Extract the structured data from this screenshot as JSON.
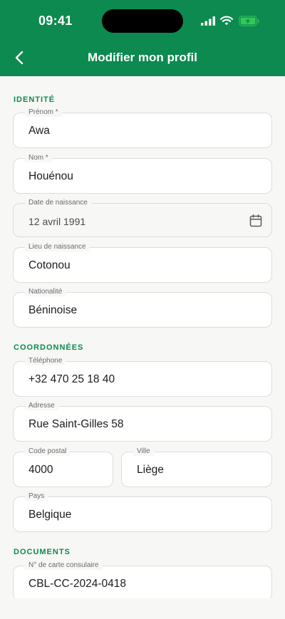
{
  "status": {
    "time": "09:41"
  },
  "nav": {
    "title": "Modifier mon profil"
  },
  "sections": {
    "identity": "IDENTITÉ",
    "contact": "COORDONNÉES",
    "documents": "DOCUMENTS"
  },
  "fields": {
    "first_name": {
      "label": "Prénom *",
      "value": "Awa"
    },
    "last_name": {
      "label": "Nom *",
      "value": "Houénou"
    },
    "birth_date": {
      "label": "Date de naissance",
      "value": "12 avril 1991"
    },
    "birth_place": {
      "label": "Lieu de naissance",
      "value": "Cotonou"
    },
    "nationality": {
      "label": "Nationalité",
      "value": "Béninoise"
    },
    "phone": {
      "label": "Téléphone",
      "value": "+32 470 25 18 40"
    },
    "address": {
      "label": "Adresse",
      "value": "Rue Saint-Gilles 58"
    },
    "postal_code": {
      "label": "Code postal",
      "value": "4000"
    },
    "city": {
      "label": "Ville",
      "value": "Liège"
    },
    "country": {
      "label": "Pays",
      "value": "Belgique"
    },
    "consular_card": {
      "label": "N° de carte consulaire",
      "value": "CBL-CC-2024-0418"
    }
  },
  "icons": {
    "back": "chevron-left-icon",
    "calendar": "calendar-icon",
    "signal": "cellular-signal-icon",
    "wifi": "wifi-icon",
    "battery": "battery-charging-icon"
  },
  "colors": {
    "brand": "#0c8a4f",
    "battery": "#34c759",
    "background": "#f7f7f5"
  }
}
